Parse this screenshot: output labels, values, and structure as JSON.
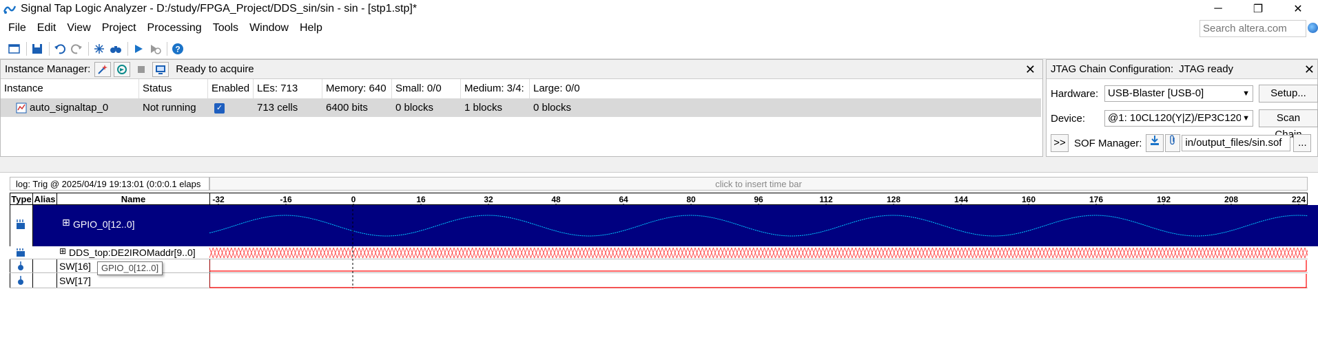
{
  "window": {
    "title": "Signal Tap Logic Analyzer - D:/study/FPGA_Project/DDS_sin/sin - sin - [stp1.stp]*",
    "min_label": "─",
    "max_label": "❐",
    "close_label": "✕"
  },
  "menu": [
    "File",
    "Edit",
    "View",
    "Project",
    "Processing",
    "Tools",
    "Window",
    "Help"
  ],
  "search": {
    "placeholder": "Search altera.com"
  },
  "instance_manager": {
    "label": "Instance Manager:",
    "status": "Ready to acquire",
    "close": "✕",
    "columns": [
      "Instance",
      "Status",
      "Enabled",
      "LEs: 713",
      "Memory: 640",
      "Small: 0/0",
      "Medium: 3/4:",
      "Large: 0/0"
    ],
    "row": {
      "instance": "auto_signaltap_0",
      "status": "Not running",
      "enabled": true,
      "les": "713 cells",
      "memory": "6400 bits",
      "small": "0 blocks",
      "medium": "1 blocks",
      "large": "0 blocks"
    }
  },
  "jtag": {
    "label": "JTAG Chain Configuration:",
    "status": "JTAG ready",
    "close": "✕",
    "hardware_label": "Hardware:",
    "hardware_value": "USB-Blaster [USB-0]",
    "setup_button": "Setup...",
    "device_label": "Device:",
    "device_value": "@1: 10CL120(Y|Z)/EP3C120",
    "scan_button": "Scan Chain",
    "expand_button": ">>",
    "sof_label": "SOF Manager:",
    "sof_path": "in/output_files/sin.sof",
    "browse_button": "..."
  },
  "waveform": {
    "log_label": "log: Trig @ 2025/04/19 19:13:01 (0:0:0.1 elaps",
    "time_bar_hint": "click to insert time bar",
    "headers": {
      "type": "Type",
      "alias": "Alias",
      "name": "Name"
    },
    "ticks": [
      "-32",
      "-16",
      "0",
      "16",
      "32",
      "48",
      "64",
      "80",
      "96",
      "112",
      "128",
      "144",
      "160",
      "176",
      "192",
      "208",
      "224"
    ],
    "signals": [
      {
        "name": "GPIO_0[12..0]",
        "kind": "bus",
        "expandable": true
      },
      {
        "name": "DDS_top:DE2IROMaddr[9..0]",
        "kind": "bus",
        "expandable": true
      },
      {
        "name": "SW[16]",
        "kind": "bit",
        "expandable": false
      },
      {
        "name": "SW[17]",
        "kind": "bit",
        "expandable": false
      }
    ],
    "tooltip": "GPIO_0[12..0]",
    "colors": {
      "bus_bg": "#000080",
      "sine": "#00c8ff",
      "addr_bus": "#ff3030",
      "bit_line": "#ff0000"
    }
  }
}
